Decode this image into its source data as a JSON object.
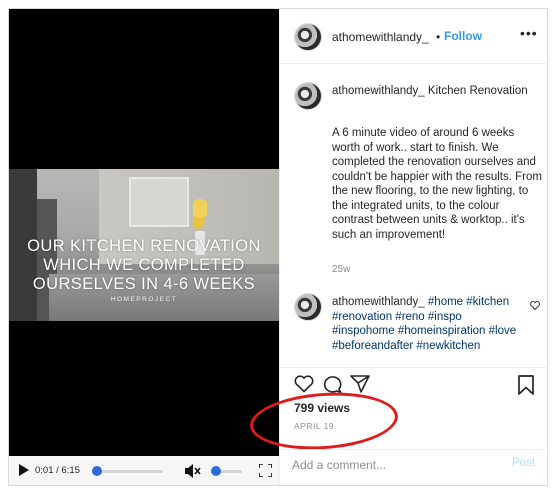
{
  "post": {
    "username": "athomewithlandy_",
    "follow_separator": "•",
    "follow_label": "Follow",
    "more_label": "•••"
  },
  "video": {
    "overlay_line1": "OUR KITCHEN RENOVATION",
    "overlay_line2": "WHICH WE COMPLETED",
    "overlay_line3": "OURSELVES IN 4-6 WEEKS",
    "overlay_sub": "HOMEPROJECT",
    "time": "0:01 / 6:15",
    "progress_fraction": 0.003,
    "volume_fraction": 0.0
  },
  "caption": {
    "username": "athomewithlandy_",
    "title_line": "Kitchen Renovation",
    "body": "A 6 minute video of around 6 weeks worth of work.. start to finish. We completed the renovation ourselves and couldn't be happier with the results. From the new flooring, to the new lighting, to the integrated units, to the colour contrast between units & worktop.. it's such an improvement!",
    "time": "25w"
  },
  "comment": {
    "username": "athomewithlandy_",
    "tags": "#home #kitchen #renovation #reno #inspo #inspohome #homeinspiration #love #beforeandafter #newkitchen"
  },
  "stats": {
    "views": "799 views",
    "date": "APRIL 19"
  },
  "add_comment": {
    "placeholder": "Add a comment...",
    "post_label": "Post"
  },
  "colors": {
    "link_blue": "#3897f0",
    "annotation_red": "#e01b1b",
    "player_accent": "#2e6bd6"
  }
}
